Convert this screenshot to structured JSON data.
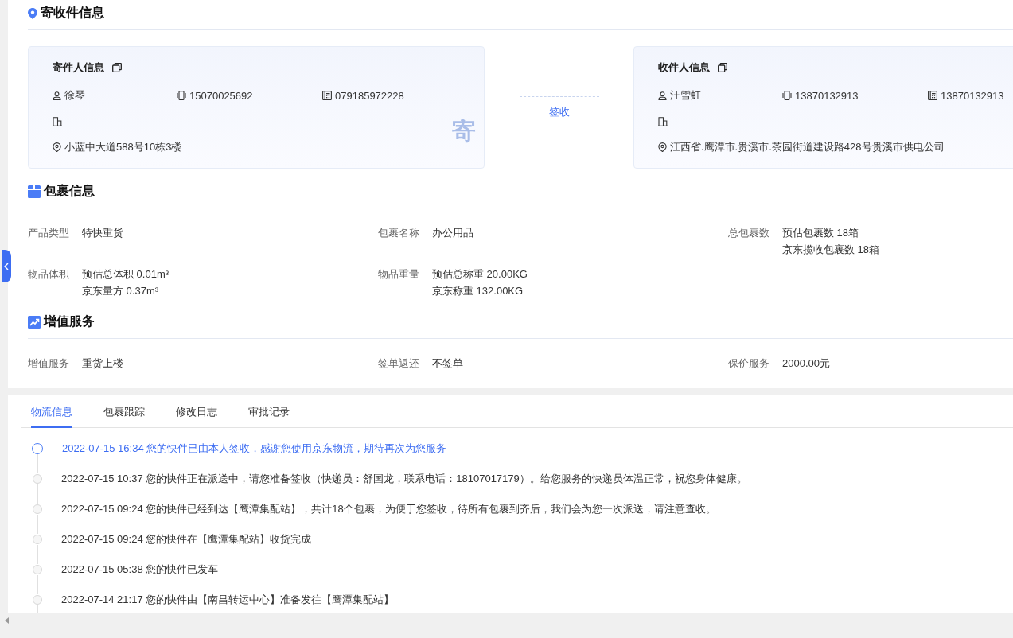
{
  "address_section": {
    "title": "寄收件信息",
    "sender": {
      "title": "寄件人信息",
      "name": "徐琴",
      "mobile": "15070025692",
      "phone": "079185972228",
      "address": "小蓝中大道588号10栋3楼",
      "stamp": "寄"
    },
    "connector_label": "签收",
    "receiver": {
      "title": "收件人信息",
      "name": "汪雪虹",
      "mobile": "13870132913",
      "phone": "13870132913",
      "address": "江西省.鹰潭市.贵溪市.茶园街道建设路428号贵溪市供电公司"
    }
  },
  "package_section": {
    "title": "包裹信息",
    "fields": [
      {
        "label": "产品类型",
        "values": [
          "特快重货"
        ]
      },
      {
        "label": "包裹名称",
        "values": [
          "办公用品"
        ]
      },
      {
        "label": "总包裹数",
        "values": [
          "预估包裹数 18箱",
          "京东揽收包裹数 18箱"
        ]
      },
      {
        "label": "物品体积",
        "values": [
          "预估总体积 0.01m³",
          "京东量方 0.37m³"
        ]
      },
      {
        "label": "物品重量",
        "values": [
          "预估总称重 20.00KG",
          "京东称重 132.00KG"
        ]
      }
    ]
  },
  "service_section": {
    "title": "增值服务",
    "fields": [
      {
        "label": "增值服务",
        "values": [
          "重货上楼"
        ]
      },
      {
        "label": "签单返还",
        "values": [
          "不签单"
        ]
      },
      {
        "label": "保价服务",
        "values": [
          "2000.00元"
        ]
      }
    ]
  },
  "tabs": [
    {
      "label": "物流信息",
      "selected": true
    },
    {
      "label": "包裹跟踪",
      "selected": false
    },
    {
      "label": "修改日志",
      "selected": false
    },
    {
      "label": "审批记录",
      "selected": false
    }
  ],
  "timeline": [
    {
      "text": "2022-07-15 16:34 您的快件已由本人签收，感谢您使用京东物流，期待再次为您服务",
      "current": true
    },
    {
      "text": "2022-07-15 10:37 您的快件正在派送中，请您准备签收（快递员：舒国龙，联系电话：18107017179）。给您服务的快递员体温正常，祝您身体健康。",
      "current": false
    },
    {
      "text": "2022-07-15 09:24 您的快件已经到达【鹰潭集配站】，共计18个包裹，为便于您签收，待所有包裹到齐后，我们会为您一次派送，请注意查收。",
      "current": false
    },
    {
      "text": "2022-07-15 09:24 您的快件在【鹰潭集配站】收货完成",
      "current": false
    },
    {
      "text": "2022-07-15 05:38 您的快件已发车",
      "current": false
    },
    {
      "text": "2022-07-14 21:17 您的快件由【南昌转运中心】准备发往【鹰潭集配站】",
      "current": false
    }
  ]
}
